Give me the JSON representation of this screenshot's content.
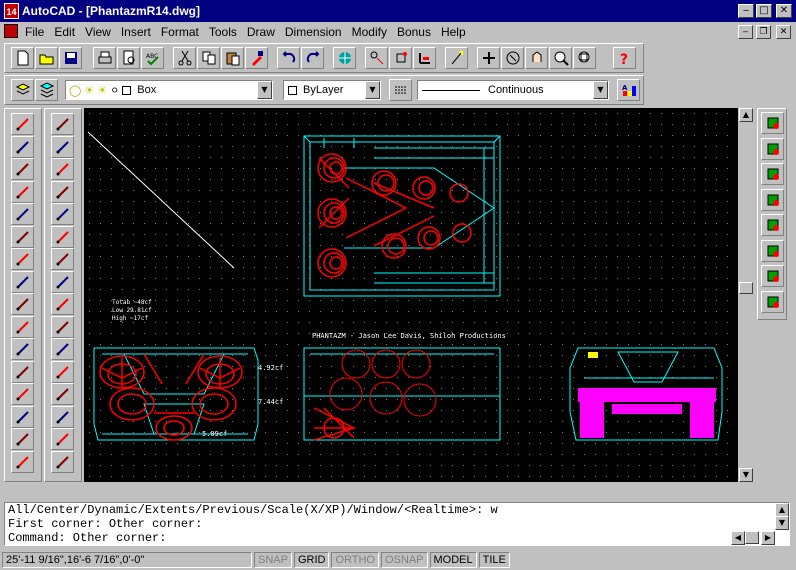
{
  "window": {
    "title": "AutoCAD - [PhantazmR14.dwg]",
    "app_icon_text": "14"
  },
  "menu": [
    "File",
    "Edit",
    "View",
    "Insert",
    "Format",
    "Tools",
    "Draw",
    "Dimension",
    "Modify",
    "Bonus",
    "Help"
  ],
  "layer_combo": {
    "value": "Box"
  },
  "color_combo": {
    "value": "ByLayer"
  },
  "linetype_combo": {
    "value": "Continuous"
  },
  "drawing": {
    "volume_label": "Totab  ~48cf\nLow  29.81cf\nHigh  ~17cf",
    "volume_lines": [
      "Totab  ~48cf",
      "Low  29.81cf",
      "High  ~17cf"
    ],
    "caption": "PHANTAZM  -  Jason Lee Davis, Shiloh Productions",
    "dim_labels": [
      "4.92cf",
      "7.44cf",
      "5.09cf"
    ],
    "colors": {
      "bg": "#000000",
      "cyan": "#00ffff",
      "red": "#ff0000",
      "magenta": "#ff00ff",
      "yellow": "#ffff00",
      "white": "#ffffff"
    }
  },
  "command_lines": [
    "All/Center/Dynamic/Extents/Previous/Scale(X/XP)/Window/<Realtime>: w",
    "First corner: Other corner:",
    "Command: Other corner:"
  ],
  "status": {
    "coords": "25'-11 9/16\",16'-6 7/16\",0'-0\"",
    "toggles": [
      {
        "label": "SNAP",
        "active": false
      },
      {
        "label": "GRID",
        "active": true
      },
      {
        "label": "ORTHO",
        "active": false
      },
      {
        "label": "OSNAP",
        "active": false
      },
      {
        "label": "MODEL",
        "active": true
      },
      {
        "label": "TILE",
        "active": true
      }
    ]
  },
  "icons": {
    "standard_toolbar": [
      "new-icon",
      "open-icon",
      "save-icon",
      "print-icon",
      "print-preview-icon",
      "spell-icon",
      "cut-icon",
      "copy-icon",
      "paste-icon",
      "match-properties-icon",
      "undo-icon",
      "redo-icon",
      "launch-browser-icon",
      "tracking-icon",
      "object-snap-icon",
      "ucs-icon",
      "inquiry-icon",
      "redraw-icon",
      "pan-icon",
      "zoom-realtime-icon",
      "zoom-window-icon",
      "aerial-view-icon",
      "help-icon"
    ],
    "draw_toolbar": [
      "line-icon",
      "construction-line-icon",
      "multiline-icon",
      "polyline-icon",
      "polygon-icon",
      "rectangle-icon",
      "arc-icon",
      "circle-icon",
      "spline-icon",
      "ellipse-icon",
      "insert-block-icon",
      "make-block-icon",
      "point-icon",
      "hatch-icon",
      "region-icon",
      "text-icon"
    ],
    "modify_toolbar": [
      "erase-icon",
      "copy-object-icon",
      "mirror-icon",
      "offset-icon",
      "array-icon",
      "move-icon",
      "rotate-icon",
      "scale-icon",
      "stretch-icon",
      "lengthen-icon",
      "trim-icon",
      "extend-icon",
      "break-icon",
      "chamfer-icon",
      "fillet-icon",
      "explode-icon"
    ],
    "right_toolbar": [
      "ref-attach-icon",
      "ref-reload-icon",
      "layer-manager-icon",
      "external-bind-icon",
      "open-folder-icon",
      "export-icon",
      "clip-icon",
      "query-icon"
    ]
  }
}
